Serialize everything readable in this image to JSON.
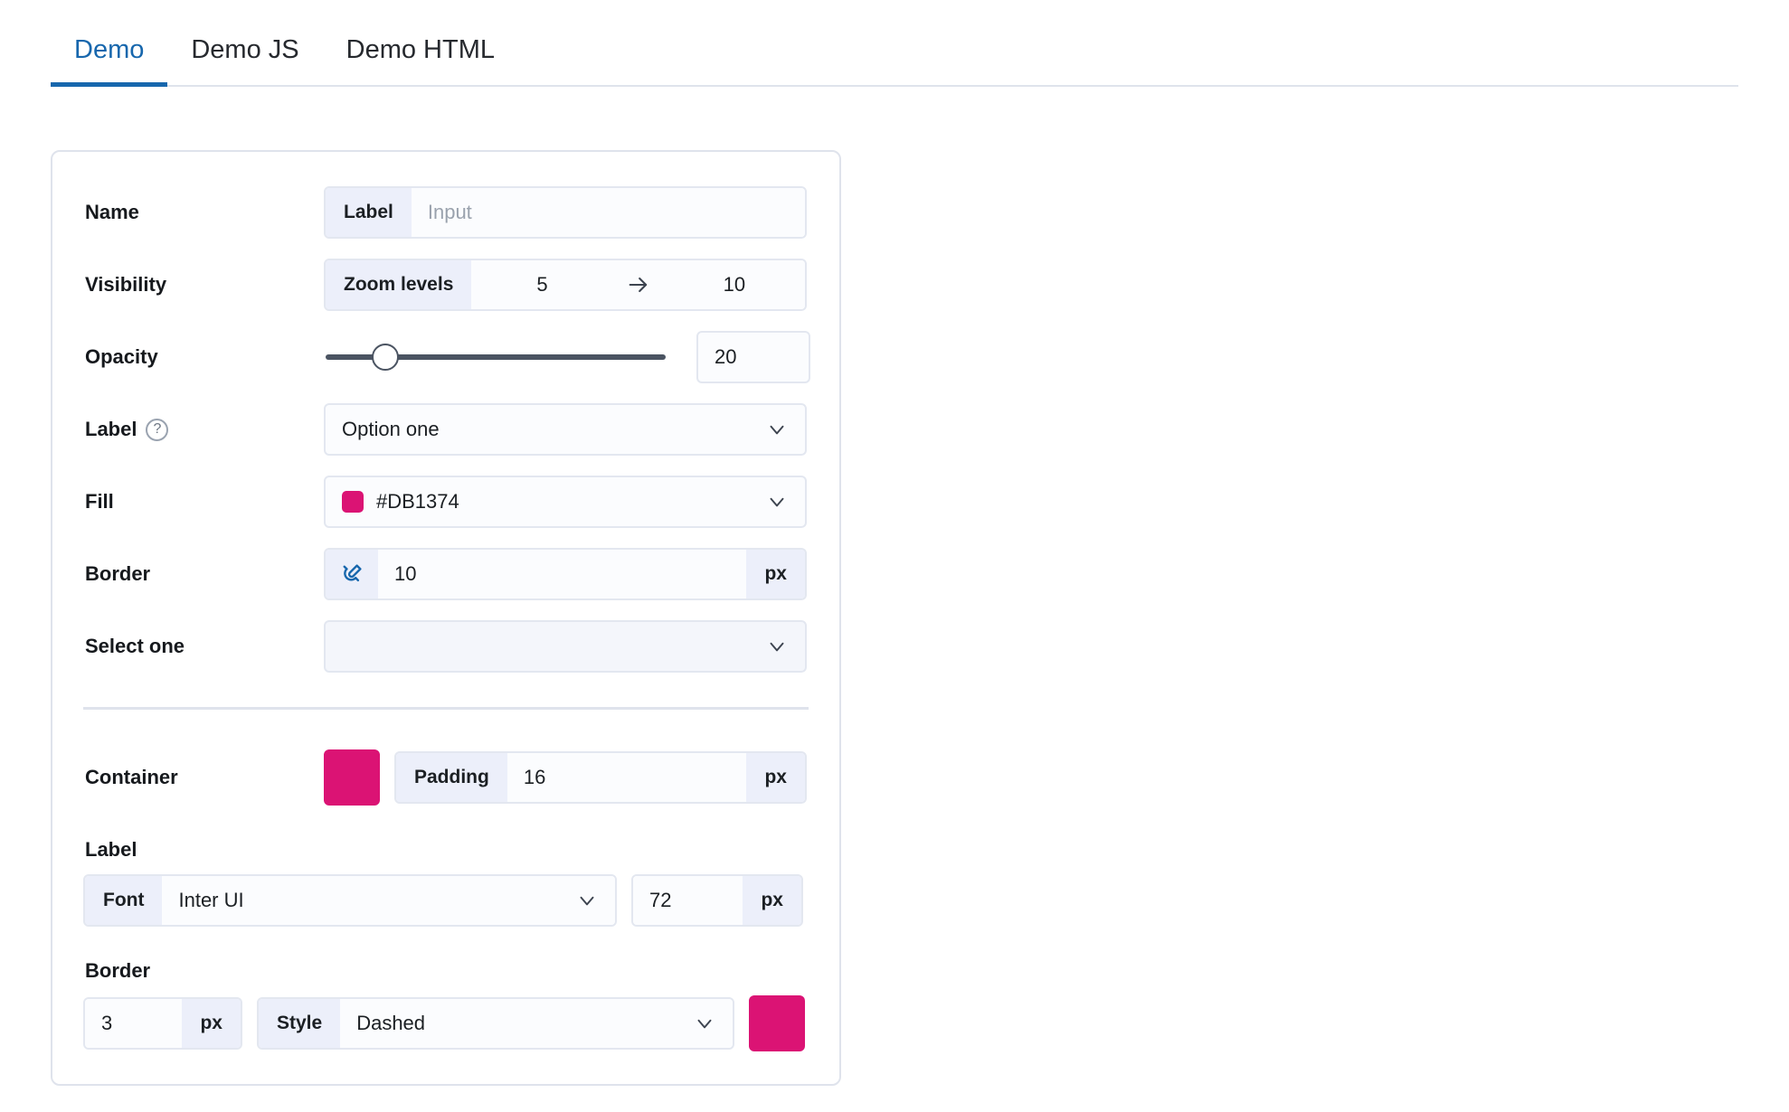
{
  "tabs": [
    {
      "label": "Demo",
      "active": true
    },
    {
      "label": "Demo JS",
      "active": false
    },
    {
      "label": "Demo HTML",
      "active": false
    }
  ],
  "colors": {
    "accent_blue": "#1767ad",
    "pink": "#DB1374",
    "border": "#dfe3ec",
    "seg_bg": "#eceffa"
  },
  "form": {
    "name": {
      "label": "Name",
      "segment_label": "Label",
      "input_placeholder": "Input",
      "input_value": ""
    },
    "visibility": {
      "label": "Visibility",
      "segment_label": "Zoom levels",
      "from_value": "5",
      "arrow": "→",
      "to_value": "10"
    },
    "opacity": {
      "label": "Opacity",
      "value": "20",
      "slider_percent": 18
    },
    "label_select": {
      "label": "Label",
      "help_icon": "?",
      "selected": "Option one"
    },
    "fill": {
      "label": "Fill",
      "selected": "#DB1374",
      "swatch_color": "#DB1374"
    },
    "border": {
      "label": "Border",
      "icon": "magnet-icon",
      "value": "10",
      "unit": "px"
    },
    "select_one": {
      "label": "Select one",
      "selected": ""
    },
    "container": {
      "label": "Container",
      "swatch_color": "#DB1374",
      "padding_label": "Padding",
      "padding_value": "16",
      "unit": "px"
    },
    "label_group": {
      "heading": "Label",
      "font_segment_label": "Font",
      "font_value": "Inter UI",
      "size_value": "72",
      "unit": "px"
    },
    "border_group": {
      "heading": "Border",
      "width_value": "3",
      "unit": "px",
      "style_segment_label": "Style",
      "style_value": "Dashed",
      "swatch_color": "#DB1374"
    }
  }
}
